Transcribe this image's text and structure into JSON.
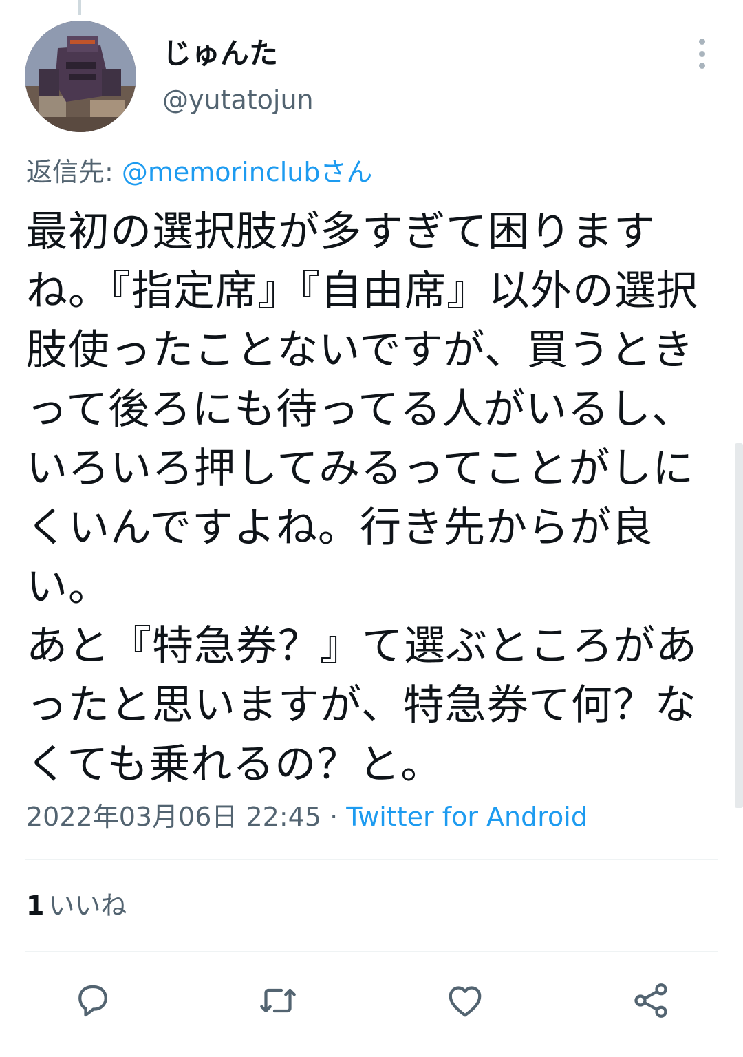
{
  "tweet": {
    "display_name": "じゅんた",
    "handle": "@yutatojun",
    "reply_prefix": "返信先: ",
    "reply_mention": "@memorinclubさん",
    "text": "最初の選択肢が多すぎて困りますね。『指定席』『自由席』以外の選択肢使ったことないですが、買うときって後ろにも待ってる人がいるし、いろいろ押してみるってことがしにくいんですよね。行き先からが良い。\nあと『特急券？』て選ぶところがあったと思いますが、特急券て何？なくても乗れるの？と。",
    "timestamp": "2022年03月06日 22:45",
    "meta_separator": " · ",
    "source": "Twitter for Android",
    "likes_count": "1",
    "likes_label": "いいね"
  },
  "actions": {
    "reply_icon": "reply-icon",
    "retweet_icon": "retweet-icon",
    "like_icon": "like-icon",
    "share_icon": "share-icon"
  },
  "colors": {
    "text": "#0f1419",
    "secondary": "#536471",
    "link": "#1d9bf0",
    "divider": "#eff3f4",
    "icon": "#536471"
  }
}
